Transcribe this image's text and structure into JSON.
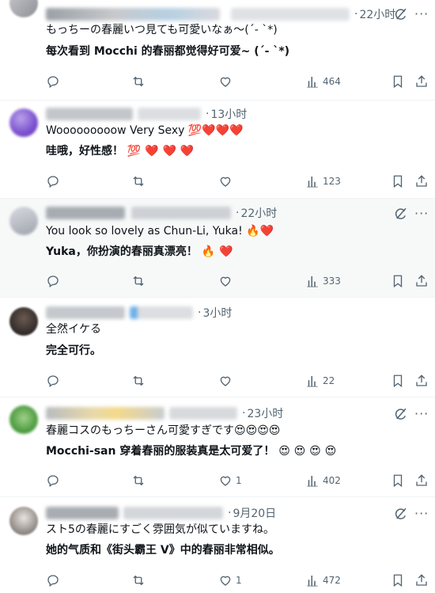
{
  "replies": [
    {
      "time": "22小时",
      "text": "もっちーの春麗いつ見ても可愛いなぁ〜(´- `*)",
      "translation": "每次看到 Mocchi 的春丽都觉得好可爱~ (´- `*)",
      "views": "464",
      "likes": ""
    },
    {
      "time": "13小时",
      "text": "Wooooooooow Very Sexy 💯❤️❤️❤️",
      "translation": "哇哦，好性感！ 💯 ❤️ ❤️ ❤️",
      "views": "123",
      "likes": ""
    },
    {
      "time": "22小时",
      "text": "You look so lovely as Chun-Li, Yuka! 🔥❤️",
      "translation": "Yuka，你扮演的春丽真漂亮！ 🔥 ❤️",
      "views": "333",
      "likes": ""
    },
    {
      "time": "3小时",
      "text": "全然イケる",
      "translation": "完全可行。",
      "views": "22",
      "likes": ""
    },
    {
      "time": "23小时",
      "text": "春麗コスのもっちーさん可愛すぎです😍😍😍😍",
      "translation": "Mocchi-san 穿着春丽的服装真是太可爱了！ 😍 😍 😍 😍",
      "views": "402",
      "likes": "1"
    },
    {
      "time": "9月20日",
      "text": "スト5の春麗にすごく雰囲気が似ていますね。",
      "translation": "她的气质和《街头霸王 V》中的春丽非常相似。",
      "views": "472",
      "likes": "1"
    }
  ],
  "icons": {
    "reply": "reply-icon",
    "retweet": "retweet-icon",
    "like": "like-heart-icon",
    "views": "views-bar-chart-icon",
    "bookmark": "bookmark-icon",
    "share": "share-upload-icon",
    "grok": "grok-icon",
    "more": "more-dots-icon"
  },
  "colors": {
    "text": "#0f1419",
    "secondary": "#536471",
    "border": "#eff3f4",
    "highlight": "#f7f9f9"
  }
}
